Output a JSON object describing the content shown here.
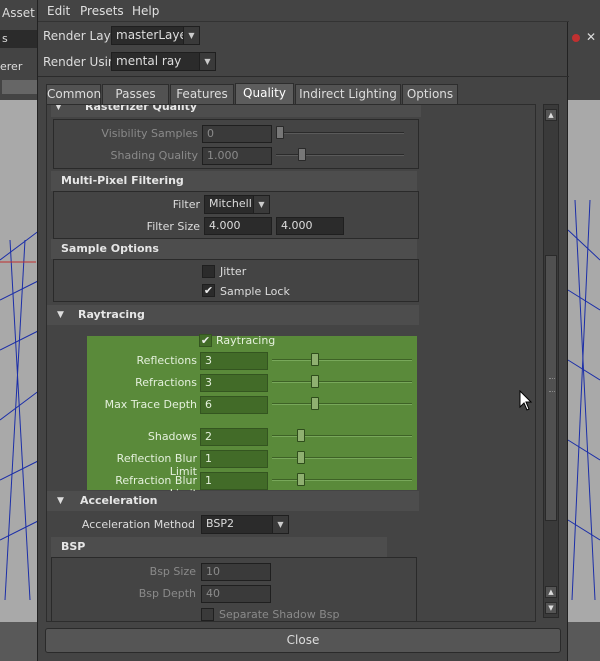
{
  "background": {
    "left_tab": "Asset",
    "left_row2": "s",
    "left_row3": "erer"
  },
  "menubar": {
    "items": [
      "Edit",
      "Presets",
      "Help"
    ]
  },
  "render_layer": {
    "label": "Render Layer",
    "value": "masterLayer"
  },
  "render_using": {
    "label": "Render Using",
    "value": "mental ray"
  },
  "tabs": [
    {
      "label": "Common"
    },
    {
      "label": "Passes"
    },
    {
      "label": "Features"
    },
    {
      "label": "Quality",
      "active": true
    },
    {
      "label": "Indirect Lighting"
    },
    {
      "label": "Options"
    }
  ],
  "rasterizer": {
    "title": "Rasterizer Quality",
    "visibility_samples_label": "Visibility Samples",
    "visibility_samples_value": "0",
    "shading_quality_label": "Shading Quality",
    "shading_quality_value": "1.000"
  },
  "multipixel": {
    "title": "Multi-Pixel Filtering",
    "filter_label": "Filter",
    "filter_value": "Mitchell",
    "filter_size_label": "Filter Size",
    "filter_size_x": "4.000",
    "filter_size_y": "4.000"
  },
  "sample_options": {
    "title": "Sample Options",
    "jitter_label": "Jitter",
    "jitter_checked": false,
    "sample_lock_label": "Sample Lock",
    "sample_lock_checked": true
  },
  "raytracing": {
    "title": "Raytracing",
    "enable_label": "Raytracing",
    "enable_checked": true,
    "reflections_label": "Reflections",
    "reflections_value": "3",
    "refractions_label": "Refractions",
    "refractions_value": "3",
    "max_trace_label": "Max Trace Depth",
    "max_trace_value": "6",
    "shadows_label": "Shadows",
    "shadows_value": "2",
    "refl_blur_label": "Reflection Blur Limit",
    "refl_blur_value": "1",
    "refr_blur_label": "Refraction Blur Limit",
    "refr_blur_value": "1",
    "highlight_color": "#5a8a3a"
  },
  "acceleration": {
    "title": "Acceleration",
    "method_label": "Acceleration Method",
    "method_value": "BSP2"
  },
  "bsp": {
    "title": "BSP",
    "bsp_size_label": "Bsp Size",
    "bsp_size_value": "10",
    "bsp_depth_label": "Bsp Depth",
    "bsp_depth_value": "40",
    "separate_shadow_label": "Separate Shadow Bsp"
  },
  "footer": {
    "close_label": "Close"
  }
}
